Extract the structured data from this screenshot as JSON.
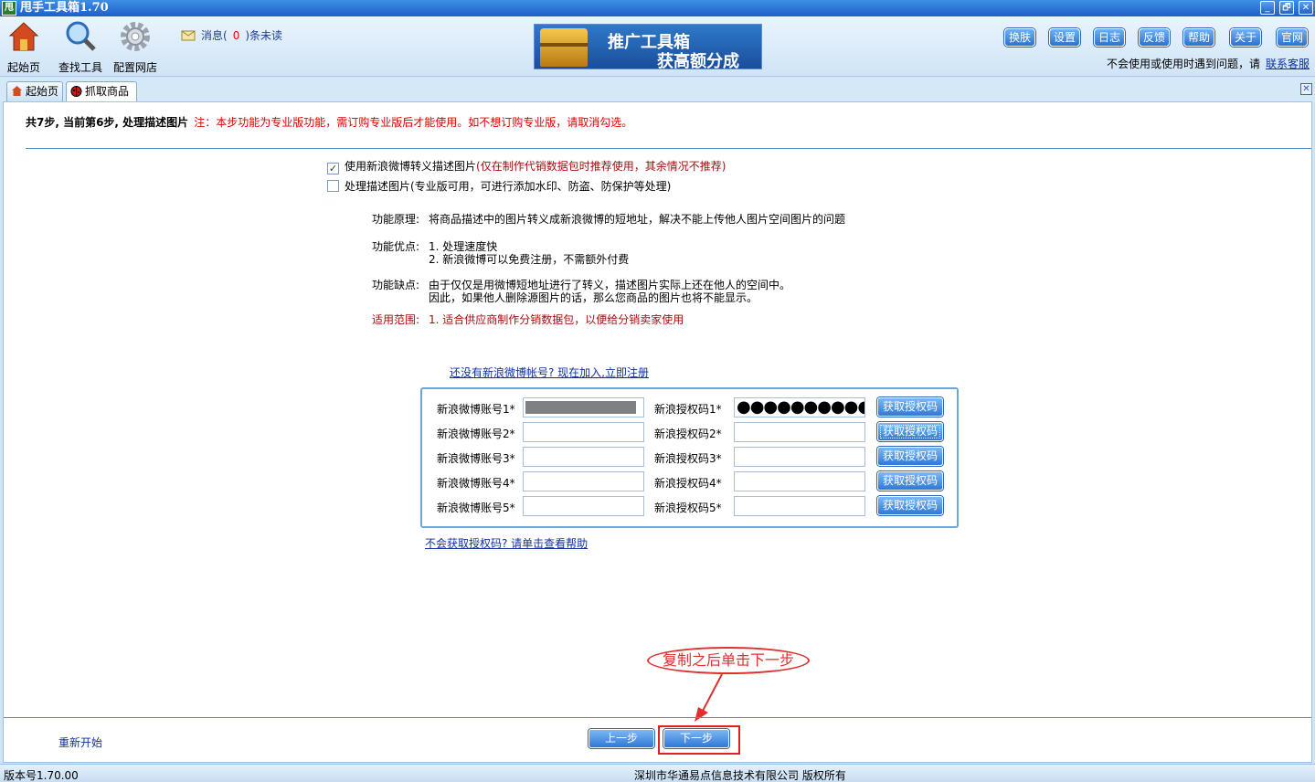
{
  "window": {
    "icon_text": "甩",
    "title": "甩手工具箱1.70",
    "controls": [
      "_",
      "🗗",
      "✕"
    ]
  },
  "toolbar": {
    "tools": [
      {
        "label": "起始页",
        "icon": "home-icon"
      },
      {
        "label": "查找工具",
        "icon": "magnifier-icon"
      },
      {
        "label": "配置网店",
        "icon": "gear-icon"
      }
    ],
    "message_prefix": "消息(",
    "message_count": "0",
    "message_suffix": ")条未读",
    "banner_line1": "推广工具箱",
    "banner_line2": "获高额分成",
    "buttons": [
      "换肤",
      "设置",
      "日志",
      "反馈",
      "帮助",
      "关于",
      "官网"
    ],
    "support_text": "不会使用或使用时遇到问题，请",
    "support_link": "联系客服"
  },
  "tabs": [
    {
      "label": "起始页",
      "icon": "home-icon",
      "active": false
    },
    {
      "label": "抓取商品",
      "icon": "ladybug-icon",
      "active": true
    }
  ],
  "tab_close": "✕",
  "main": {
    "step_text": "共7步, 当前第6步, 处理描述图片",
    "step_note": "注：本步功能为专业版功能，需订购专业版后才能使用。如不想订购专业版，请取消勾选。",
    "option1": {
      "checked": true,
      "label": "使用新浪微博转义描述图片",
      "hint": "(仅在制作代销数据包时推荐使用，其余情况不推荐)"
    },
    "option2": {
      "checked": false,
      "label": "处理描述图片(专业版可用，可进行添加水印、防盗、防保护等处理)"
    },
    "principle_key": "功能原理:",
    "principle_val": "将商品描述中的图片转义成新浪微博的短地址，解决不能上传他人图片空间图片的问题",
    "pros_key": "功能优点:",
    "pros_1": "1. 处理速度快",
    "pros_2": "2. 新浪微博可以免费注册，不需额外付费",
    "cons_key": "功能缺点:",
    "cons_1": "由于仅仅是用微博短地址进行了转义，描述图片实际上还在他人的空间中。",
    "cons_2": "因此，如果他人删除源图片的话，那么您商品的图片也将不能显示。",
    "scope_key": "适用范围:",
    "scope_val": "1. 适合供应商制作分销数据包，以便给分销卖家使用",
    "register_link": "还没有新浪微博帐号? 现在加入,立即注册",
    "accounts": [
      {
        "account_label": "新浪微博账号1*",
        "auth_label": "新浪授权码1*",
        "auth_value": "●●●●●●●●●●●●●",
        "button": "获取授权码"
      },
      {
        "account_label": "新浪微博账号2*",
        "auth_label": "新浪授权码2*",
        "auth_value": "",
        "button": "获取授权码"
      },
      {
        "account_label": "新浪微博账号3*",
        "auth_label": "新浪授权码3*",
        "auth_value": "",
        "button": "获取授权码"
      },
      {
        "account_label": "新浪微博账号4*",
        "auth_label": "新浪授权码4*",
        "auth_value": "",
        "button": "获取授权码"
      },
      {
        "account_label": "新浪微博账号5*",
        "auth_label": "新浪授权码5*",
        "auth_value": "",
        "button": "获取授权码"
      }
    ],
    "help_link": "不会获取授权码? 请单击查看帮助",
    "annotation": "复制之后单击下一步",
    "restart": "重新开始",
    "prev": "上一步",
    "next": "下一步"
  },
  "status": {
    "version": "版本号1.70.00",
    "copyright": "深圳市华通易点信息技术有限公司 版权所有"
  }
}
